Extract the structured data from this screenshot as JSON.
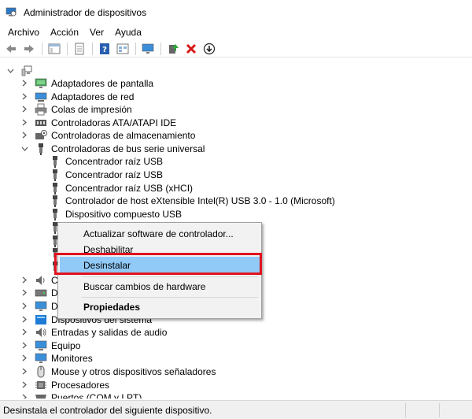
{
  "window": {
    "title": "Administrador de dispositivos"
  },
  "menubar": {
    "items": [
      "Archivo",
      "Acción",
      "Ver",
      "Ayuda"
    ]
  },
  "toolbar": {
    "buttons": [
      "back-icon",
      "forward-icon",
      "show-hide-tree-icon",
      "properties-icon",
      "help-icon",
      "view-icon",
      "monitor-icon",
      "update-driver-icon",
      "uninstall-icon",
      "disable-icon"
    ]
  },
  "tree": {
    "root": {
      "label": "",
      "icon": "computer-icon"
    },
    "categories": [
      {
        "label": "Adaptadores de pantalla",
        "icon": "display-adapter-icon",
        "expanded": false
      },
      {
        "label": "Adaptadores de red",
        "icon": "network-adapter-icon",
        "expanded": false
      },
      {
        "label": "Colas de impresión",
        "icon": "print-queue-icon",
        "expanded": false
      },
      {
        "label": "Controladoras ATA/ATAPI IDE",
        "icon": "ide-controller-icon",
        "expanded": false
      },
      {
        "label": "Controladoras de almacenamiento",
        "icon": "storage-controller-icon",
        "expanded": false
      },
      {
        "label": "Controladoras de bus serie universal",
        "icon": "usb-icon",
        "expanded": true
      }
    ],
    "usb_children": [
      "Concentrador raíz USB",
      "Concentrador raíz USB",
      "Concentrador raíz USB (xHCI)",
      "Controlador de host eXtensible Intel(R) USB 3.0 - 1.0 (Microsoft)",
      "Dispositivo compuesto USB"
    ],
    "partial_categories": [
      {
        "label": "Co",
        "icon": "speaker-icon"
      },
      {
        "label": "Dis",
        "icon": "disk-icon"
      },
      {
        "label": "Dis",
        "icon": "monitor-icon"
      }
    ],
    "more_categories": [
      {
        "label": "Dispositivos del sistema",
        "icon": "system-device-icon"
      },
      {
        "label": "Entradas y salidas de audio",
        "icon": "audio-icon"
      },
      {
        "label": "Equipo",
        "icon": "computer-icon"
      },
      {
        "label": "Monitores",
        "icon": "monitor-icon"
      },
      {
        "label": "Mouse y otros dispositivos señaladores",
        "icon": "mouse-icon"
      },
      {
        "label": "Procesadores",
        "icon": "processor-icon"
      },
      {
        "label": "Puertos (COM y LPT)",
        "icon": "port-icon"
      }
    ]
  },
  "context_menu": {
    "items": [
      {
        "label": "Actualizar software de controlador...",
        "highlighted": false,
        "bold": false
      },
      {
        "label": "Deshabilitar",
        "highlighted": false,
        "bold": false
      },
      {
        "label": "Desinstalar",
        "highlighted": true,
        "bold": false
      },
      {
        "label": "Buscar cambios de hardware",
        "highlighted": false,
        "bold": false
      },
      {
        "label": "Propiedades",
        "highlighted": false,
        "bold": true
      }
    ]
  },
  "statusbar": {
    "text": "Desinstala el controlador del siguiente dispositivo."
  },
  "colors": {
    "menu_highlight": "#91c9f7",
    "annotation_box": "#e0121e",
    "folder_blue": "#1e7bd6"
  }
}
